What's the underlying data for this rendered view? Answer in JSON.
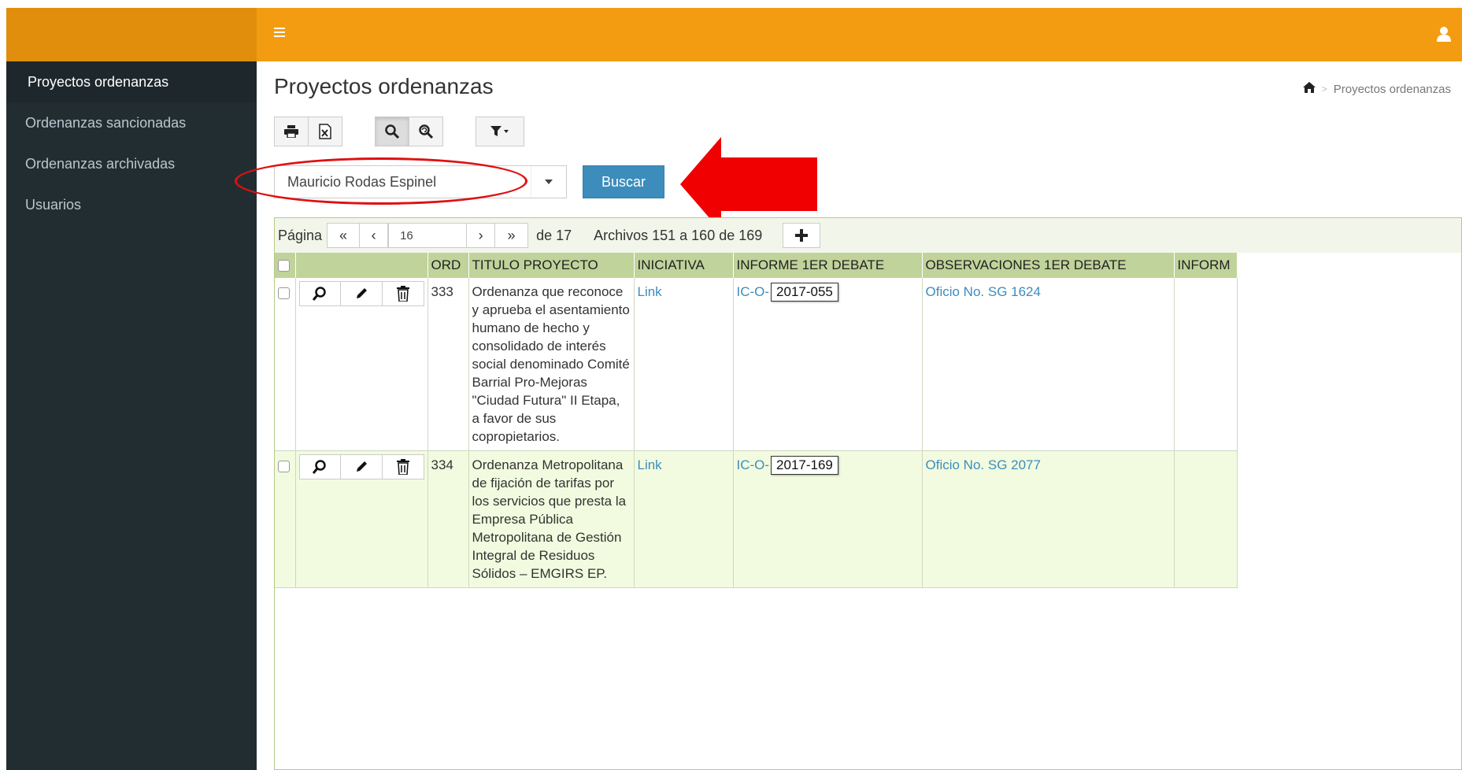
{
  "header": {
    "menu_icon": "hamburger-icon",
    "user_icon": "user-icon"
  },
  "sidebar": {
    "items": [
      {
        "label": "Proyectos ordenanzas",
        "active": true
      },
      {
        "label": "Ordenanzas sancionadas"
      },
      {
        "label": "Ordenanzas archivadas"
      },
      {
        "label": "Usuarios"
      }
    ]
  },
  "main": {
    "title": "Proyectos ordenanzas",
    "breadcrumb": {
      "home_icon": "home-icon",
      "separator": ">",
      "current": "Proyectos ordenanzas"
    },
    "toolbar": {
      "icons": [
        "print-icon",
        "excel-icon",
        "search-icon",
        "zoom-reset-icon",
        "filter-icon"
      ]
    },
    "search": {
      "selected": "Mauricio Rodas Espinel",
      "button": "Buscar"
    },
    "pager": {
      "label": "Página",
      "first": "«",
      "prev": "‹",
      "page": "16",
      "next": "›",
      "last": "»",
      "of": "de 17",
      "records": "Archivos 151 a 160 de 169",
      "add_icon": "plus-icon"
    },
    "table": {
      "columns": [
        "ORD",
        "TITULO PROYECTO",
        "INICIATIVA",
        "INFORME 1ER DEBATE",
        "OBSERVACIONES 1ER DEBATE",
        "INFORM"
      ],
      "rows": [
        {
          "ord": "333",
          "titulo": "Ordenanza que reconoce y aprueba el asentamiento humano de hecho y consolidado de interés social denominado Comité Barrial Pro-Mejoras \"Ciudad Futura\" II Etapa, a favor de sus copropietarios.",
          "iniciativa": "Link",
          "informe_prefix": "IC-O-",
          "informe_code": "2017-055",
          "observaciones": "Oficio No. SG 1624"
        },
        {
          "ord": "334",
          "titulo": "Ordenanza Metropolitana de fijación de tarifas por los servicios que presta la Empresa Pública Metropolitana de Gestión Integral de Residuos Sólidos – EMGIRS EP.",
          "iniciativa": "Link",
          "informe_prefix": "IC-O-",
          "informe_code": "2017-169",
          "observaciones": "Oficio No. SG 2077"
        }
      ]
    }
  },
  "colors": {
    "header": "#f39c12",
    "sidebar": "#222d32",
    "button": "#3c8dbc",
    "annotation": "#e01010",
    "table_header": "#c0d39a"
  }
}
